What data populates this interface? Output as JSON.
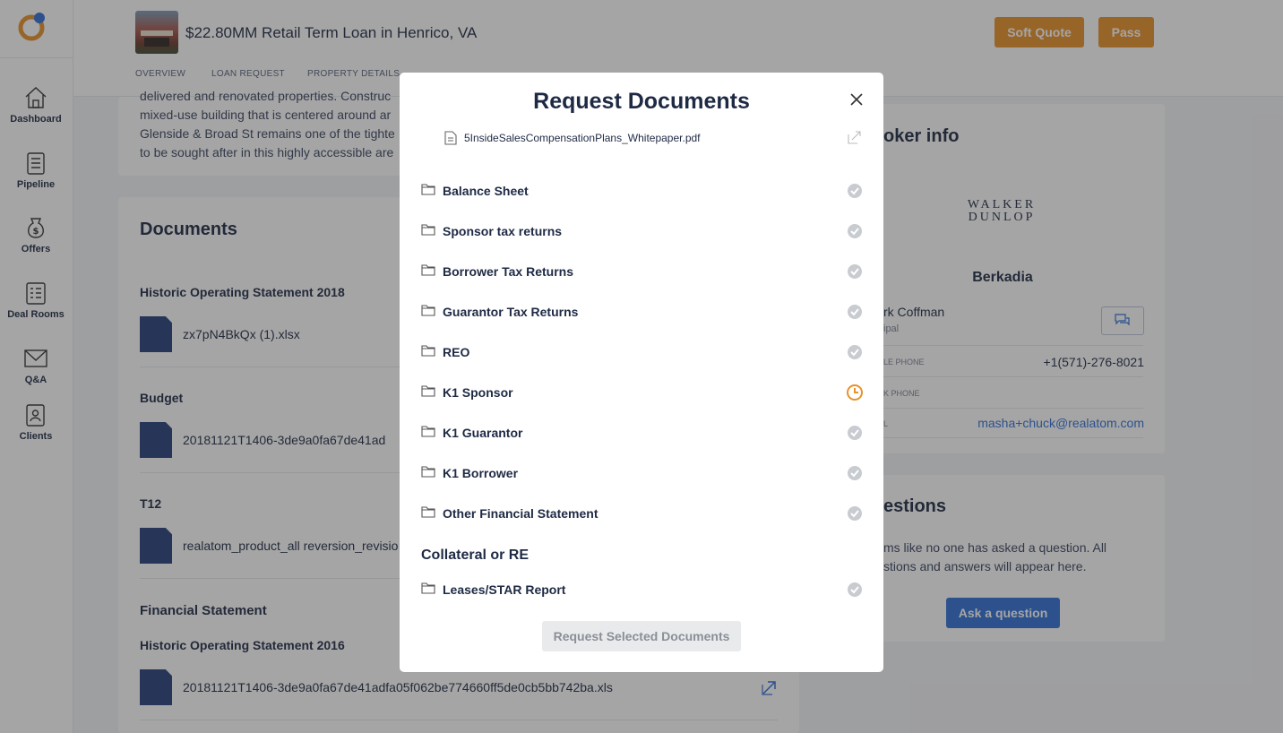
{
  "nav": {
    "items": [
      {
        "label": "Dashboard"
      },
      {
        "label": "Pipeline"
      },
      {
        "label": "Offers"
      },
      {
        "label": "Deal Rooms"
      },
      {
        "label": "Q&A"
      },
      {
        "label": "Clients"
      }
    ]
  },
  "header": {
    "title": "$22.80MM Retail Term Loan in Henrico, VA",
    "soft_quote": "Soft Quote",
    "pass": "Pass",
    "tabs": [
      "OVERVIEW",
      "LOAN REQUEST",
      "PROPERTY DETAILS"
    ]
  },
  "description": {
    "lines": [
      "delivered and renovated properties. Construc",
      "mixed-use building that is centered around ar",
      "Glenside & Broad St remains one of the tighte",
      "to be sought after in this highly accessible are"
    ]
  },
  "documents": {
    "title": "Documents",
    "groups": [
      {
        "heading": "Historic Operating Statement 2018",
        "file": "zx7pN4BkQx (1).xlsx"
      },
      {
        "heading": "Budget",
        "file": "20181121T1406-3de9a0fa67de41ad"
      },
      {
        "heading": "T12",
        "file": "realatom_product_all reversion_revisio"
      }
    ],
    "section2": "Financial Statement",
    "group4": {
      "heading": "Historic Operating Statement 2016",
      "file": "20181121T1406-3de9a0fa67de41adfa05f062be774660ff5de0cb5bb742ba.xls"
    }
  },
  "broker": {
    "title": "oker info",
    "company_logo_line1": "WALKER",
    "company_logo_line2": "DUNLOP",
    "company": "Berkadia",
    "name": "rk Coffman",
    "role": "ipal",
    "mobile_label": "LE PHONE",
    "mobile": "+1(571)-276-8021",
    "work_label": "K PHONE",
    "email_label": "L",
    "email": "masha+chuck@realatom.com"
  },
  "questions": {
    "title": "estions",
    "line1": "ms like no one has asked a question. All",
    "line2": "stions and answers will appear here.",
    "button": "Ask a question"
  },
  "modal": {
    "title": "Request Documents",
    "file": "5InsideSalesCompensationPlans_Whitepaper.pdf",
    "rows": [
      {
        "label": "Balance Sheet",
        "status": "done"
      },
      {
        "label": "Sponsor tax returns",
        "status": "done"
      },
      {
        "label": "Borrower Tax Returns",
        "status": "done"
      },
      {
        "label": "Guarantor Tax Returns",
        "status": "done"
      },
      {
        "label": "REO",
        "status": "done"
      },
      {
        "label": "K1 Sponsor",
        "status": "pending"
      },
      {
        "label": "K1 Guarantor",
        "status": "done"
      },
      {
        "label": "K1 Borrower",
        "status": "done"
      },
      {
        "label": "Other Financial Statement",
        "status": "done"
      }
    ],
    "section": "Collateral or RE",
    "section_rows": [
      {
        "label": "Leases/STAR Report",
        "status": "done"
      }
    ],
    "button": "Request Selected Documents"
  },
  "colors": {
    "accent_orange": "#e8922a",
    "navy": "#1e2a44",
    "doc_blue": "#27407a",
    "link_blue": "#2f6fd6"
  }
}
